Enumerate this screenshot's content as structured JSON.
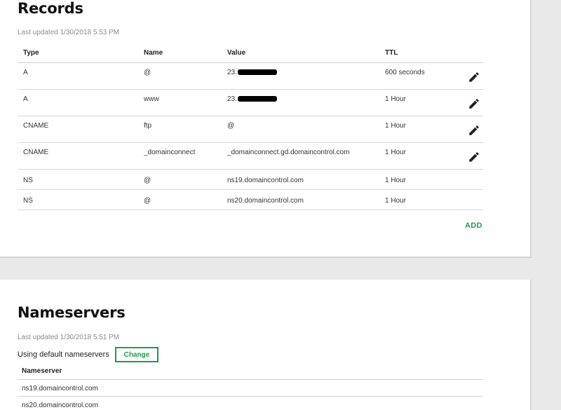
{
  "records": {
    "title": "Records",
    "last_updated": "Last updated 1/30/2018 5:53 PM",
    "columns": {
      "type": "Type",
      "name": "Name",
      "value": "Value",
      "ttl": "TTL"
    },
    "rows": [
      {
        "type": "A",
        "name": "@",
        "value": "23.",
        "value_redacted": true,
        "ttl": "600 seconds",
        "editable": true
      },
      {
        "type": "A",
        "name": "www",
        "value": "23.",
        "value_redacted": true,
        "ttl": "1 Hour",
        "editable": true
      },
      {
        "type": "CNAME",
        "name": "ftp",
        "value": "@",
        "value_redacted": false,
        "ttl": "1 Hour",
        "editable": true
      },
      {
        "type": "CNAME",
        "name": "_domainconnect",
        "value": "_domainconnect.gd.domaincontrol.com",
        "value_redacted": false,
        "ttl": "1 Hour",
        "editable": true
      },
      {
        "type": "NS",
        "name": "@",
        "value": "ns19.domaincontrol.com",
        "value_redacted": false,
        "ttl": "1 Hour",
        "editable": false
      },
      {
        "type": "NS",
        "name": "@",
        "value": "ns20.domaincontrol.com",
        "value_redacted": false,
        "ttl": "1 Hour",
        "editable": false
      }
    ],
    "edit_icon": "pencil-icon",
    "add_label": "ADD"
  },
  "nameservers": {
    "title": "Nameservers",
    "last_updated": "Last updated 1/30/2018 5:51 PM",
    "using_text": "Using default nameservers",
    "change_label": "Change",
    "column": "Nameserver",
    "rows": [
      "ns19.domaincontrol.com",
      "ns20.domaincontrol.com"
    ]
  },
  "colors": {
    "accent": "#1f9c47",
    "muted_text": "#8c8c8c",
    "page_bg": "#e9e9e9"
  }
}
